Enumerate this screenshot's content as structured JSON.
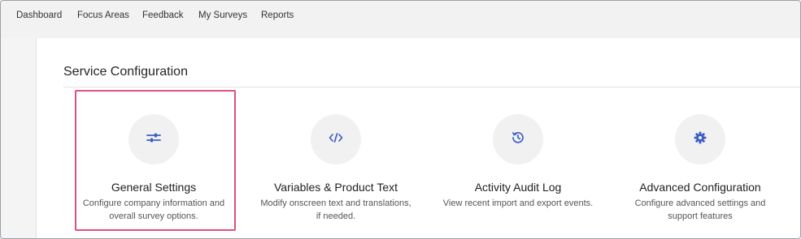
{
  "nav": {
    "items": [
      {
        "label": "Dashboard"
      },
      {
        "label": "Focus Areas"
      },
      {
        "label": "Feedback"
      },
      {
        "label": "My Surveys"
      },
      {
        "label": "Reports"
      }
    ]
  },
  "page": {
    "section_title": "Service Configuration"
  },
  "cards": [
    {
      "title": "General Settings",
      "description": "Configure company information and overall survey options.",
      "icon": "sliders-icon"
    },
    {
      "title": "Variables & Product Text",
      "description": "Modify onscreen text and translations, if needed.",
      "icon": "code-icon"
    },
    {
      "title": "Activity Audit Log",
      "description": "View recent import and export events.",
      "icon": "history-icon"
    },
    {
      "title": "Advanced Configuration",
      "description": "Configure advanced settings and support features",
      "icon": "gear-icon"
    }
  ],
  "colors": {
    "icon_blue": "#3d5fc4",
    "selection_pink": "#e0507f"
  }
}
